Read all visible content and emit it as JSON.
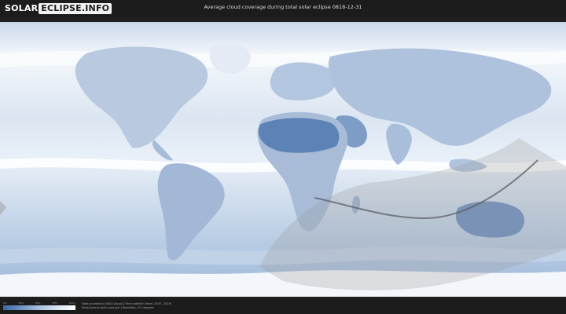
{
  "header": {
    "logo_solar": "SOLAR",
    "logo_eclipse": "ECLIPSE.INFO",
    "title": "Average cloud coverage during total solar eclipse 0818-12-31"
  },
  "map": {
    "ocean_color": "#e9f0f8",
    "cloud_color": "#f7fafd",
    "clear_sky_color": "#5d82b6",
    "path_color": "#9a9a9a",
    "centerline_color": "#5a5f66"
  },
  "legend": {
    "ticks": [
      "0%",
      "25%",
      "50%",
      "75%",
      "100%"
    ]
  },
  "footer": {
    "credit_line1": "Data provided by NASA (Aqua & Terra satellite (Years: 2003 - 2019)",
    "credit_line2": "https://neo.sci.gsfc.nasa.gov  |  Resolution: 0.1 degrees"
  }
}
